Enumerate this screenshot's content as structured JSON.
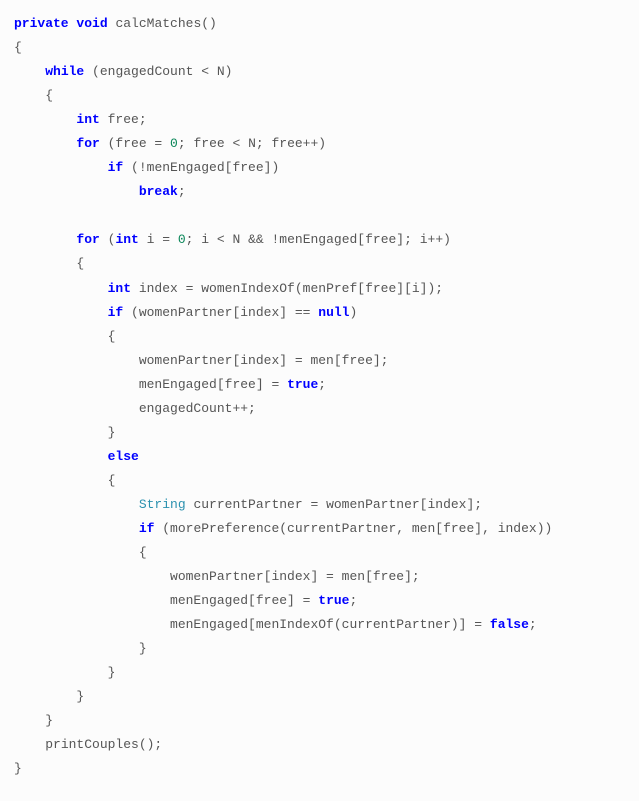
{
  "code": {
    "lines": [
      {
        "indent": 0,
        "tokens": [
          {
            "t": "private",
            "c": "kw"
          },
          {
            "t": " "
          },
          {
            "t": "void",
            "c": "kw"
          },
          {
            "t": " calcMatches()"
          }
        ]
      },
      {
        "indent": 0,
        "tokens": [
          {
            "t": "{"
          }
        ]
      },
      {
        "indent": 1,
        "tokens": [
          {
            "t": "while",
            "c": "kw"
          },
          {
            "t": " (engagedCount < N)"
          }
        ]
      },
      {
        "indent": 1,
        "tokens": [
          {
            "t": "{"
          }
        ]
      },
      {
        "indent": 2,
        "tokens": [
          {
            "t": "int",
            "c": "kw"
          },
          {
            "t": " free;"
          }
        ]
      },
      {
        "indent": 2,
        "tokens": [
          {
            "t": "for",
            "c": "kw"
          },
          {
            "t": " (free = "
          },
          {
            "t": "0",
            "c": "num"
          },
          {
            "t": "; free < N; free++)"
          }
        ]
      },
      {
        "indent": 3,
        "tokens": [
          {
            "t": "if",
            "c": "kw"
          },
          {
            "t": " (!menEngaged[free])"
          }
        ]
      },
      {
        "indent": 4,
        "tokens": [
          {
            "t": "break",
            "c": "kw"
          },
          {
            "t": ";"
          }
        ]
      },
      {
        "indent": 0,
        "tokens": [
          {
            "t": ""
          }
        ]
      },
      {
        "indent": 2,
        "tokens": [
          {
            "t": "for",
            "c": "kw"
          },
          {
            "t": " ("
          },
          {
            "t": "int",
            "c": "kw"
          },
          {
            "t": " i = "
          },
          {
            "t": "0",
            "c": "num"
          },
          {
            "t": "; i < N && !menEngaged[free]; i++)"
          }
        ]
      },
      {
        "indent": 2,
        "tokens": [
          {
            "t": "{"
          }
        ]
      },
      {
        "indent": 3,
        "tokens": [
          {
            "t": "int",
            "c": "kw"
          },
          {
            "t": " index = womenIndexOf(menPref[free][i]);"
          }
        ]
      },
      {
        "indent": 3,
        "tokens": [
          {
            "t": "if",
            "c": "kw"
          },
          {
            "t": " (womenPartner[index] == "
          },
          {
            "t": "null",
            "c": "bool"
          },
          {
            "t": ")"
          }
        ]
      },
      {
        "indent": 3,
        "tokens": [
          {
            "t": "{"
          }
        ]
      },
      {
        "indent": 4,
        "tokens": [
          {
            "t": "womenPartner[index] = men[free];"
          }
        ]
      },
      {
        "indent": 4,
        "tokens": [
          {
            "t": "menEngaged[free] = "
          },
          {
            "t": "true",
            "c": "bool"
          },
          {
            "t": ";"
          }
        ]
      },
      {
        "indent": 4,
        "tokens": [
          {
            "t": "engagedCount++;"
          }
        ]
      },
      {
        "indent": 3,
        "tokens": [
          {
            "t": "}"
          }
        ]
      },
      {
        "indent": 3,
        "tokens": [
          {
            "t": "else",
            "c": "kw"
          }
        ]
      },
      {
        "indent": 3,
        "tokens": [
          {
            "t": "{"
          }
        ]
      },
      {
        "indent": 4,
        "tokens": [
          {
            "t": "String",
            "c": "str"
          },
          {
            "t": " currentPartner = womenPartner[index];"
          }
        ]
      },
      {
        "indent": 4,
        "tokens": [
          {
            "t": "if",
            "c": "kw"
          },
          {
            "t": " (morePreference(currentPartner, men[free], index))"
          }
        ]
      },
      {
        "indent": 4,
        "tokens": [
          {
            "t": "{"
          }
        ]
      },
      {
        "indent": 5,
        "tokens": [
          {
            "t": "womenPartner[index] = men[free];"
          }
        ]
      },
      {
        "indent": 5,
        "tokens": [
          {
            "t": "menEngaged[free] = "
          },
          {
            "t": "true",
            "c": "bool"
          },
          {
            "t": ";"
          }
        ]
      },
      {
        "indent": 5,
        "tokens": [
          {
            "t": "menEngaged[menIndexOf(currentPartner)] = "
          },
          {
            "t": "false",
            "c": "bool"
          },
          {
            "t": ";"
          }
        ]
      },
      {
        "indent": 4,
        "tokens": [
          {
            "t": "}"
          }
        ]
      },
      {
        "indent": 3,
        "tokens": [
          {
            "t": "}"
          }
        ]
      },
      {
        "indent": 2,
        "tokens": [
          {
            "t": "}"
          }
        ]
      },
      {
        "indent": 1,
        "tokens": [
          {
            "t": "}"
          }
        ]
      },
      {
        "indent": 1,
        "tokens": [
          {
            "t": "printCouples();"
          }
        ]
      },
      {
        "indent": 0,
        "tokens": [
          {
            "t": "}"
          }
        ]
      }
    ]
  }
}
